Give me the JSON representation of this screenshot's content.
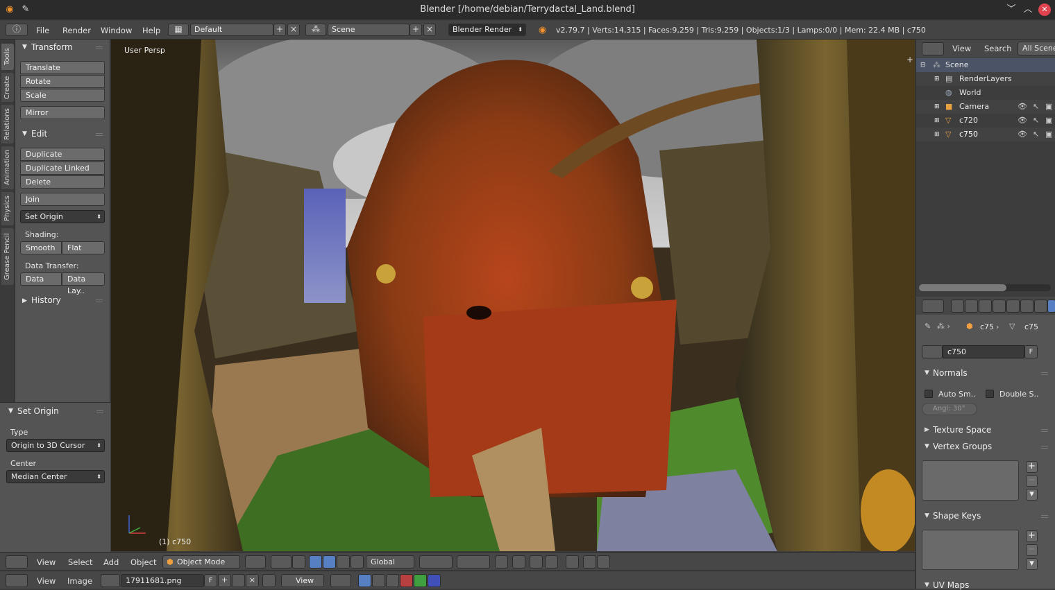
{
  "window": {
    "title": "Blender [/home/debian/Terrydactal_Land.blend]"
  },
  "info_bar": {
    "menus": [
      "File",
      "Render",
      "Window",
      "Help"
    ],
    "screen_layout": "Default",
    "scene": "Scene",
    "render_engine": "Blender Render",
    "stats": "v2.79.7 | Verts:14,315 | Faces:9,259 | Tris:9,259 | Objects:1/3 | Lamps:0/0 | Mem: 22.4 MB | c750"
  },
  "left_tabs": [
    "Tools",
    "Create",
    "Relations",
    "Animation",
    "Physics",
    "Grease Pencil"
  ],
  "tool_shelf": {
    "transform_title": "Transform",
    "translate": "Translate",
    "rotate": "Rotate",
    "scale": "Scale",
    "mirror": "Mirror",
    "edit_title": "Edit",
    "duplicate": "Duplicate",
    "duplicate_linked": "Duplicate Linked",
    "delete": "Delete",
    "join": "Join",
    "set_origin": "Set Origin",
    "shading_label": "Shading:",
    "smooth": "Smooth",
    "flat": "Flat",
    "data_transfer_label": "Data Transfer:",
    "data": "Data",
    "data_layout": "Data Lay..",
    "history_title": "History"
  },
  "operator_panel": {
    "title": "Set Origin",
    "type_label": "Type",
    "type_value": "Origin to 3D Cursor",
    "center_label": "Center",
    "center_value": "Median Center"
  },
  "viewport": {
    "view_name": "User Persp",
    "object_label": "(1) c750"
  },
  "viewport_header": {
    "menus": [
      "View",
      "Select",
      "Add",
      "Object"
    ],
    "mode": "Object Mode",
    "orientation": "Global"
  },
  "image_header": {
    "menus": [
      "View",
      "Image"
    ],
    "image_name": "17911681.png",
    "fake_user": "F",
    "view_label": "View"
  },
  "outliner": {
    "menus": [
      "View",
      "Search"
    ],
    "display_mode": "All Scenes",
    "items": [
      "Scene",
      "RenderLayers",
      "World",
      "Camera",
      "c720",
      "c750"
    ]
  },
  "properties": {
    "breadcrumb_object": "c75",
    "breadcrumb_mesh": "c75",
    "mesh_name": "c750",
    "fake_user": "F",
    "normals_title": "Normals",
    "auto_smooth": "Auto Sm..",
    "double_sided": "Double S..",
    "angle": "Angl: 30°",
    "texture_space": "Texture Space",
    "vertex_groups": "Vertex Groups",
    "shape_keys": "Shape Keys",
    "uv_maps": "UV Maps"
  },
  "colors": {
    "accent": "#e87d0d",
    "selected_blue": "#5680c2",
    "close_red": "#e0424e"
  }
}
